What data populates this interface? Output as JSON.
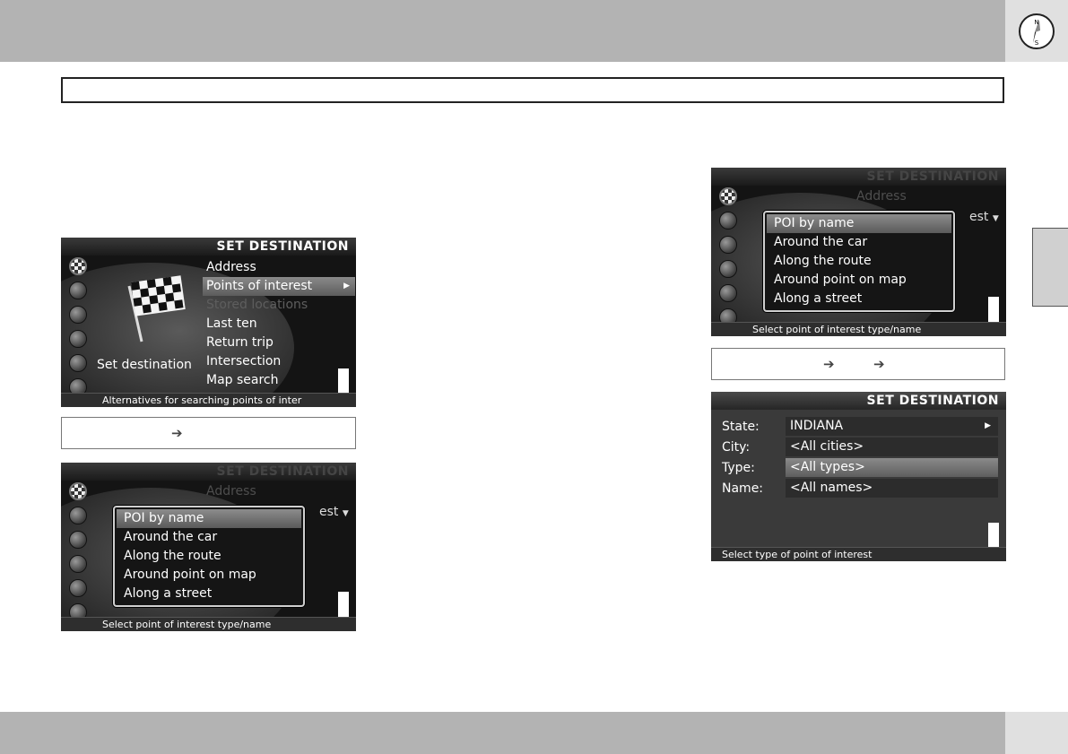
{
  "screen1": {
    "header": "SET DESTINATION",
    "set_label": "Set destination",
    "menu": [
      "Address",
      "Points of interest",
      "Stored locations",
      "Last ten",
      "Return trip",
      "Intersection",
      "Map search"
    ],
    "footer": "Alternatives for searching points of inter"
  },
  "screen2": {
    "header": "SET DESTINATION",
    "bg_address": "Address",
    "bg_fragment": "est",
    "popup": [
      "POI by name",
      "Around the car",
      "Along the route",
      "Around point on map",
      "Along a street"
    ],
    "footer": "Select point of interest type/name"
  },
  "screen3": {
    "header": "SET DESTINATION",
    "bg_address": "Address",
    "bg_fragment": "est",
    "popup": [
      "POI by name",
      "Around the car",
      "Along the route",
      "Around point on map",
      "Along a street"
    ],
    "footer": "Select point of interest type/name"
  },
  "screen4": {
    "header": "SET DESTINATION",
    "fields": [
      {
        "label": "State:",
        "value": "INDIANA"
      },
      {
        "label": "City:",
        "value": "<All cities>"
      },
      {
        "label": "Type:",
        "value": "<All types>"
      },
      {
        "label": "Name:",
        "value": "<All names>"
      }
    ],
    "footer": "Select type of point of interest"
  },
  "nav_arrow": "➔",
  "colors": {
    "band": "#b3b3b3",
    "screen_bg": "#141414",
    "highlight": "#7a7a7a"
  }
}
